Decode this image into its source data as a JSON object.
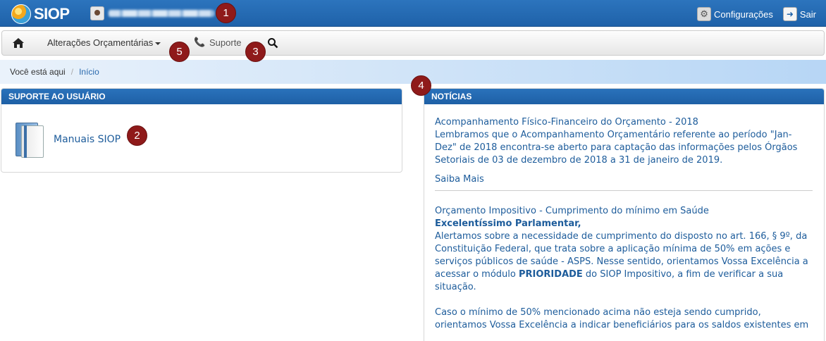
{
  "app": {
    "logo_text": "SIOP"
  },
  "topbar": {
    "settings_label": "Configurações",
    "logout_label": "Sair"
  },
  "nav": {
    "home_icon": "home-icon",
    "items": [
      {
        "label": "Alterações Orçamentárias"
      },
      {
        "label": "Suporte"
      }
    ],
    "search_icon": "search-icon"
  },
  "breadcrumb": {
    "prefix": "Você está aqui",
    "separator": "/",
    "current": "Início"
  },
  "support_panel": {
    "title": "SUPORTE AO USUÁRIO",
    "manual_link": "Manuais SIOP"
  },
  "news_panel": {
    "title": "NOTÍCIAS",
    "items": [
      {
        "headline": "Acompanhamento Físico-Financeiro do Orçamento - 2018",
        "body": "Lembramos que o Acompanhamento Orçamentário referente ao período \"Jan-Dez\" de 2018 encontra-se aberto para captação das informações pelos Órgãos Setoriais de 03 de dezembro de 2018 a 31 de janeiro de 2019.",
        "more": "Saiba Mais"
      },
      {
        "headline": "Orçamento Impositivo - Cumprimento do mínimo em Saúde",
        "salutation": "Excelentíssimo Parlamentar,",
        "body_part1": "Alertamos sobre a necessidade de cumprimento do disposto no art. 166, § 9º, da Constituição Federal, que trata sobre a aplicação mínima de 50% em ações e serviços públicos de saúde - ASPS. Nesse sentido, orientamos Vossa Excelência a acessar o módulo ",
        "body_bold": "PRIORIDADE",
        "body_part2": " do SIOP Impositivo, a fim de verificar a sua situação.",
        "body2": "Caso o mínimo de 50% mencionado acima não esteja sendo cumprido, orientamos Vossa Excelência a indicar beneficiários para os saldos existentes em"
      }
    ]
  },
  "badges": [
    "1",
    "2",
    "3",
    "4",
    "5"
  ],
  "colors": {
    "brand_blue": "#1f62a9",
    "badge": "#8f1a1a",
    "link": "#1d5c9b"
  }
}
